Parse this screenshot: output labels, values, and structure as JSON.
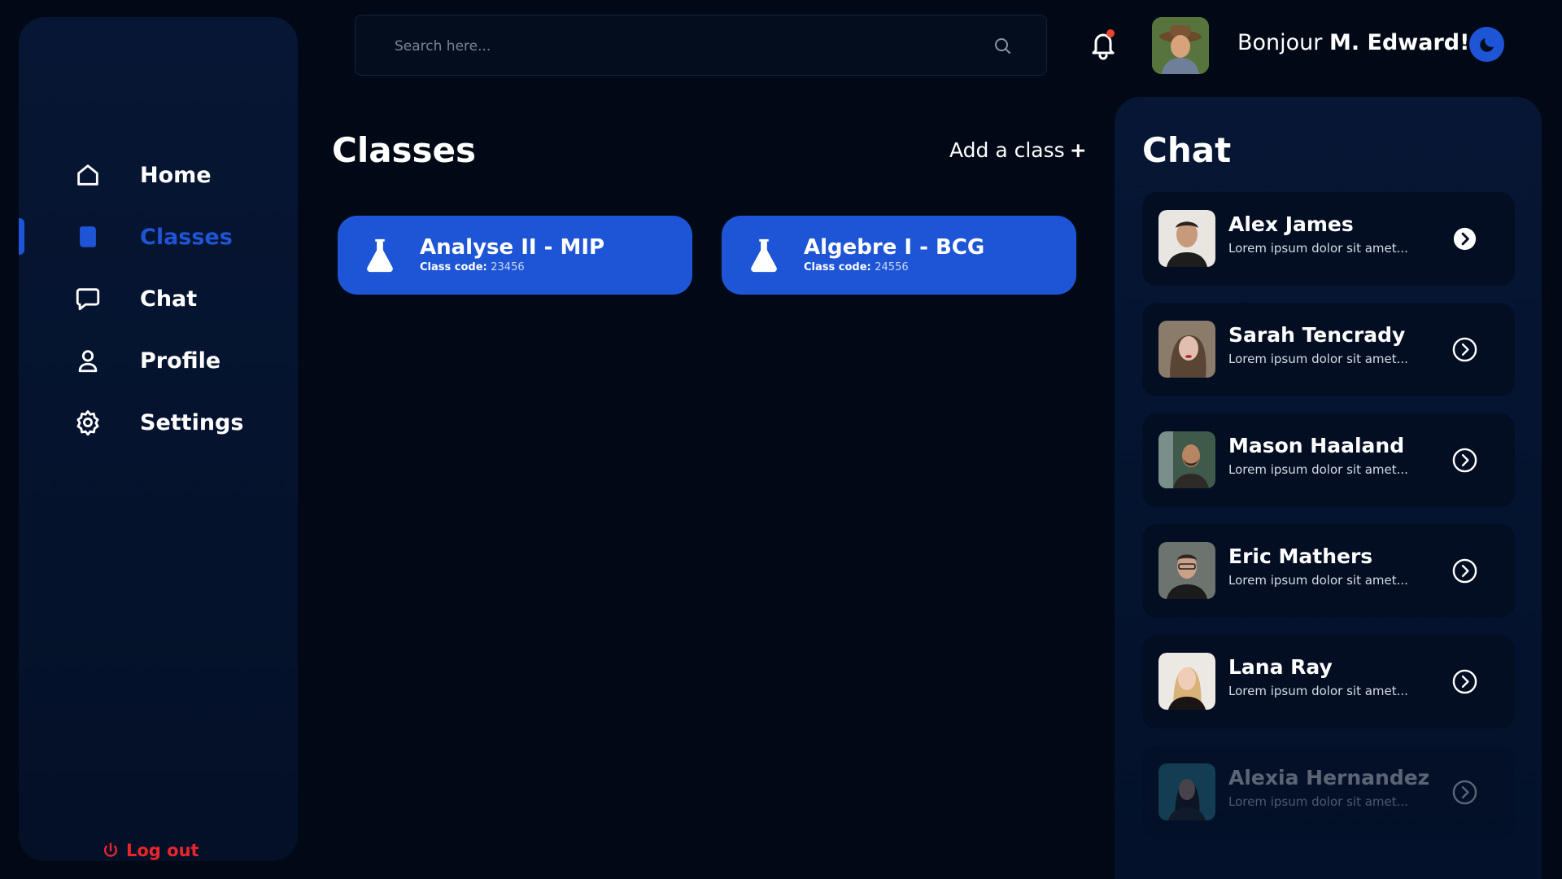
{
  "search": {
    "placeholder": "Search here..."
  },
  "header": {
    "greeting_prefix": "Bonjour ",
    "greeting_name": "M. Edward!"
  },
  "sidebar": {
    "items": [
      {
        "label": "Home",
        "icon": "home-icon"
      },
      {
        "label": "Classes",
        "icon": "book-icon",
        "active": true
      },
      {
        "label": "Chat",
        "icon": "chat-bubble-icon"
      },
      {
        "label": "Profile",
        "icon": "user-icon"
      },
      {
        "label": "Settings",
        "icon": "gear-icon"
      }
    ],
    "logout_label": "Log out"
  },
  "classes": {
    "title": "Classes",
    "add_label": "Add a class",
    "add_symbol": "+",
    "code_label": "Class code: ",
    "items": [
      {
        "name": "Analyse II - MIP",
        "code": "23456"
      },
      {
        "name": "Algebre I - BCG",
        "code": "24556"
      }
    ]
  },
  "chat": {
    "title": "Chat",
    "items": [
      {
        "name": "Alex James",
        "preview": "Lorem ipsum dolor sit amet..."
      },
      {
        "name": "Sarah Tencrady",
        "preview": "Lorem ipsum dolor sit amet..."
      },
      {
        "name": "Mason Haaland",
        "preview": "Lorem ipsum dolor sit amet..."
      },
      {
        "name": "Eric Mathers",
        "preview": "Lorem ipsum dolor sit amet..."
      },
      {
        "name": "Lana Ray",
        "preview": "Lorem ipsum dolor sit amet..."
      },
      {
        "name": "Alexia Hernandez",
        "preview": "Lorem ipsum dolor sit amet..."
      }
    ]
  },
  "colors": {
    "accent": "#1e55d6",
    "logout": "#e8262c",
    "background": "#020916",
    "panel": "#061634",
    "notification_dot": "#e8462c"
  }
}
